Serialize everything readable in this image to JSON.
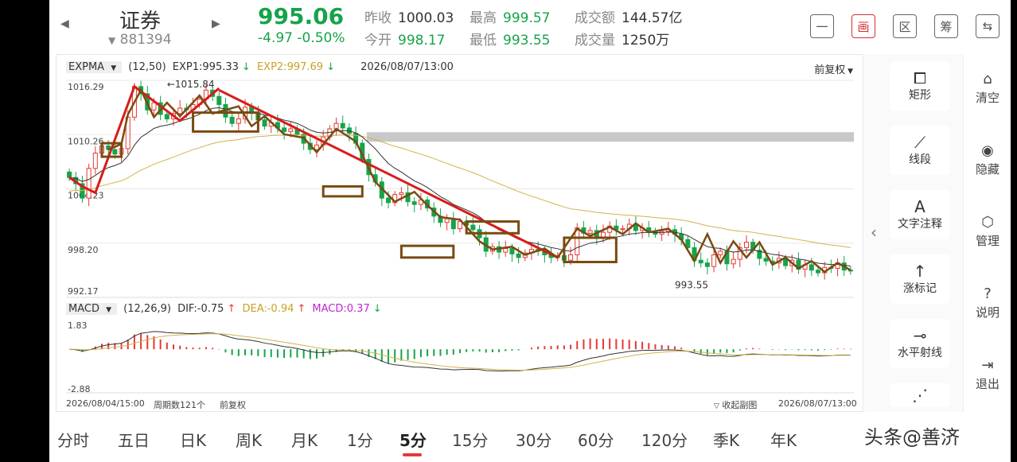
{
  "header": {
    "stock_name": "证券",
    "stock_code": "881394",
    "price": "995.06",
    "change": "-4.97 -0.50%",
    "fields": [
      {
        "k": "昨收",
        "v": "1000.03",
        "tone": "normal"
      },
      {
        "k": "最高",
        "v": "999.57",
        "tone": "green"
      },
      {
        "k": "成交额",
        "v": "144.57亿",
        "tone": "normal"
      },
      {
        "k": "今开",
        "v": "998.17",
        "tone": "green"
      },
      {
        "k": "最低",
        "v": "993.55",
        "tone": "green"
      },
      {
        "k": "成交量",
        "v": "1250万",
        "tone": "normal"
      }
    ],
    "tool_buttons": [
      {
        "name": "minus-icon",
        "glyph": "一"
      },
      {
        "name": "draw-icon",
        "glyph": "画"
      },
      {
        "name": "range-icon",
        "glyph": "区"
      },
      {
        "name": "chip-icon",
        "glyph": "筹"
      },
      {
        "name": "rotate-screen-icon",
        "glyph": "⇆"
      }
    ]
  },
  "indicator_main": {
    "name": "EXPMA",
    "params": "(12,50)",
    "exp1": "EXP1:995.33",
    "exp2": "EXP2:997.69",
    "datetime": "2026/08/07/13:00",
    "adjust": "前复权"
  },
  "indicator_sub": {
    "name": "MACD",
    "params": "(12,26,9)",
    "dif": "DIF:-0.75",
    "dea": "DEA:-0.94",
    "macd": "MACD:0.37"
  },
  "chart_labels": {
    "y_ticks": [
      "1016.29",
      "1010.26",
      "1004.23",
      "998.20",
      "992.17"
    ],
    "high_marker": "1015.84",
    "low_marker": "993.55",
    "macd_top": "1.83",
    "macd_bottom": "-2.88",
    "footer_start": "2026/08/04/15:00",
    "footer_count": "周期数121个",
    "footer_adjust": "前复权",
    "footer_collapse": "收起副图",
    "footer_end": "2026/08/07/13:00"
  },
  "colors": {
    "up": "#e53935",
    "down": "#16a34a",
    "exp1": "#333333",
    "exp2": "#d4b24a",
    "annot_red": "#d81b1b",
    "annot_brown": "#7a4a10",
    "macd_pink": "#c026d3"
  },
  "chart_data": {
    "type": "candlestick",
    "x_start": "2026/08/04/15:00",
    "x_end": "2026/08/07/13:00",
    "periods": 121,
    "ylim": [
      992.17,
      1016.29
    ],
    "y_ticks": [
      1016.29,
      1010.26,
      1004.23,
      998.2,
      992.17
    ],
    "close": [
      1005.5,
      1004.8,
      1003.2,
      1006.5,
      1008.2,
      1009.0,
      1008.6,
      1008.1,
      1008.7,
      1012.2,
      1015.6,
      1014.8,
      1013.0,
      1013.8,
      1012.5,
      1012.0,
      1012.6,
      1013.2,
      1013.0,
      1013.6,
      1014.2,
      1015.2,
      1014.5,
      1013.6,
      1012.2,
      1011.5,
      1012.0,
      1013.3,
      1012.7,
      1011.9,
      1011.2,
      1011.6,
      1011.0,
      1010.6,
      1010.9,
      1010.3,
      1009.3,
      1008.6,
      1009.1,
      1010.0,
      1010.9,
      1011.5,
      1011.0,
      1010.4,
      1009.3,
      1007.5,
      1005.8,
      1005.0,
      1003.2,
      1002.7,
      1003.6,
      1003.8,
      1002.8,
      1002.5,
      1003.0,
      1002.1,
      1001.2,
      1000.5,
      1000.9,
      999.8,
      1000.6,
      1000.2,
      999.7,
      998.8,
      997.3,
      997.8,
      997.2,
      997.6,
      997.0,
      996.6,
      997.1,
      997.5,
      997.3,
      996.9,
      996.6,
      996.8,
      996.3,
      996.9,
      999.9,
      999.3,
      999.6,
      998.8,
      999.4,
      1000.1,
      999.7,
      999.8,
      1000.3,
      999.6,
      999.9,
      999.5,
      999.2,
      999.5,
      999.7,
      999.2,
      998.6,
      997.7,
      996.3,
      996.0,
      995.6,
      996.9,
      997.3,
      995.9,
      996.4,
      997.7,
      998.3,
      997.4,
      996.5,
      996.2,
      996.0,
      996.5,
      995.7,
      996.3,
      995.3,
      995.8,
      995.2,
      994.9,
      995.5,
      995.4,
      996.0,
      995.2,
      995.1
    ],
    "exp1_value": 995.33,
    "exp2_value": 997.69,
    "low_marker": 993.55,
    "high_marker": 1015.84,
    "macd_ylim": [
      -2.88,
      1.83
    ]
  },
  "tools": [
    {
      "label": "矩形",
      "glyph": "⧠",
      "name": "rectangle-icon"
    },
    {
      "label": "线段",
      "glyph": "⟋",
      "name": "segment-icon"
    },
    {
      "label": "文字注释",
      "glyph": "A",
      "name": "text-note-icon"
    },
    {
      "label": "涨标记",
      "glyph": "↑",
      "name": "up-mark-icon"
    },
    {
      "label": "水平射线",
      "glyph": "⊸",
      "name": "horizontal-ray-icon"
    },
    {
      "label": "",
      "glyph": "⋰",
      "name": "wave-icon"
    }
  ],
  "tools2": [
    {
      "label": "清空",
      "glyph": "⌂",
      "name": "clear-icon"
    },
    {
      "label": "隐藏",
      "glyph": "◉",
      "name": "hide-icon"
    },
    {
      "label": "管理",
      "glyph": "⬡",
      "name": "manage-icon"
    },
    {
      "label": "说明",
      "glyph": "?",
      "name": "help-icon"
    },
    {
      "label": "退出",
      "glyph": "⇥",
      "name": "exit-icon"
    }
  ],
  "tabs": [
    "分时",
    "五日",
    "日K",
    "周K",
    "月K",
    "1分",
    "5分",
    "15分",
    "30分",
    "60分",
    "120分",
    "季K",
    "年K"
  ],
  "active_tab": "5分",
  "watermark": "头条@善济"
}
